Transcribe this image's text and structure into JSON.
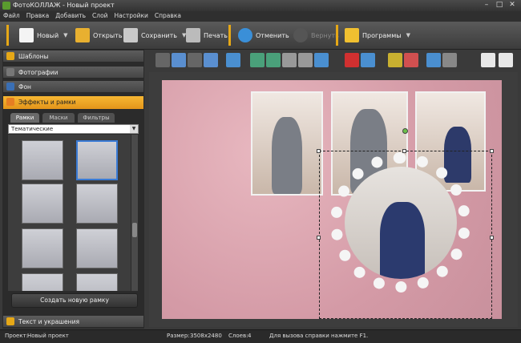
{
  "window": {
    "title": "ФотоКОЛЛАЖ - Новый проект"
  },
  "menu": [
    "Файл",
    "Правка",
    "Добавить",
    "Слой",
    "Настройки",
    "Справка"
  ],
  "toolbar": {
    "new_label": "Новый",
    "open_label": "Открыть",
    "save_label": "Сохранить",
    "print_label": "Печать",
    "undo_label": "Отменить",
    "redo_label": "Вернуть",
    "programs_label": "Программы"
  },
  "left_panel": {
    "sections": [
      "Шаблоны",
      "Фотографии",
      "Фон",
      "Эффекты и рамки"
    ],
    "tabs": [
      "Рамки",
      "Маски",
      "Фильтры"
    ],
    "category_select": "Тематические",
    "new_frame_button": "Создать новую рамку",
    "bottom_section": "Текст и украшения"
  },
  "status": {
    "project_label": "Проект:",
    "project_name": "Новый проект",
    "size_label": "Размер:",
    "size_value": "3508x2480",
    "layers_label": "Слоев:",
    "layers_value": "4",
    "help_text": "Для вызова справки нажмите F1."
  }
}
